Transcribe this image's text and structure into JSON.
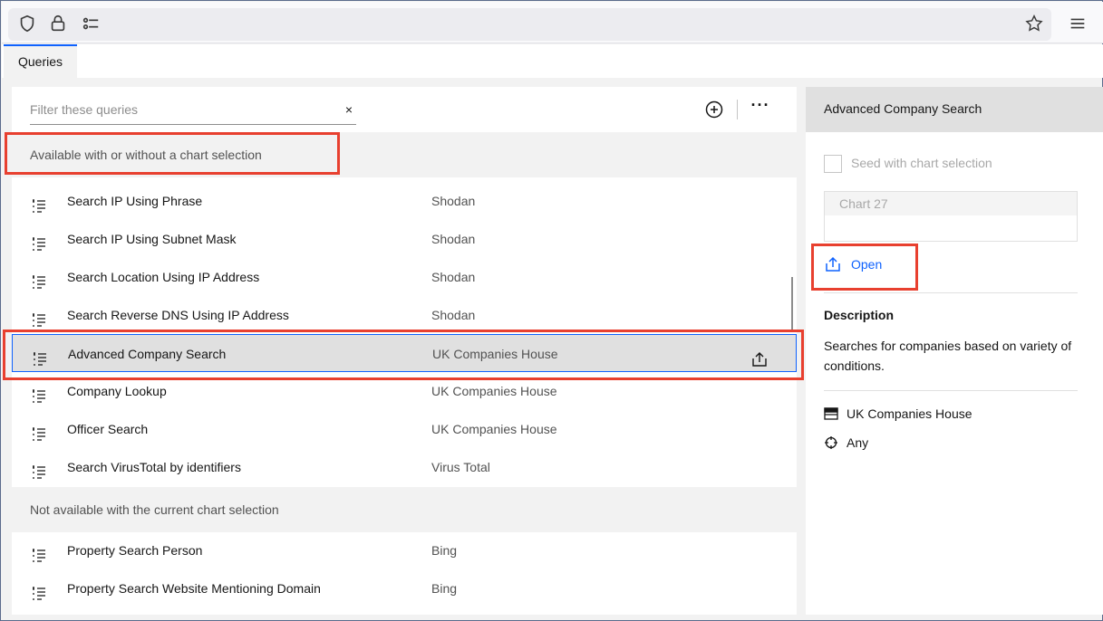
{
  "browser": {
    "icons": [
      "shield-icon",
      "lock-icon",
      "permissions-icon",
      "bookmark-star-icon",
      "hamburger-menu-icon"
    ]
  },
  "tabs": [
    {
      "label": "Queries"
    }
  ],
  "search": {
    "placeholder": "Filter these queries",
    "clear_label": "×"
  },
  "toolbar": {
    "more_label": "···"
  },
  "sections": {
    "available_label": "Available with or without a chart selection",
    "unavailable_label": "Not available with the current chart selection"
  },
  "available_queries": [
    {
      "name": "Search IP Using Phrase",
      "source": "Shodan"
    },
    {
      "name": "Search IP Using Subnet Mask",
      "source": "Shodan"
    },
    {
      "name": "Search Location Using IP Address",
      "source": "Shodan"
    },
    {
      "name": "Search Reverse DNS Using IP Address",
      "source": "Shodan"
    },
    {
      "name": "Advanced Company Search",
      "source": "UK Companies House"
    },
    {
      "name": "Company Lookup",
      "source": "UK Companies House"
    },
    {
      "name": "Officer Search",
      "source": "UK Companies House"
    },
    {
      "name": "Search VirusTotal by identifiers",
      "source": "Virus Total"
    }
  ],
  "unavailable_queries": [
    {
      "name": "Property Search Person",
      "source": "Bing"
    },
    {
      "name": "Property Search Website Mentioning Domain",
      "source": "Bing"
    }
  ],
  "details": {
    "title": "Advanced Company Search",
    "seed_label": "Seed with chart selection",
    "chart_label": "Chart 27",
    "open_label": "Open",
    "description_heading": "Description",
    "description": "Searches for companies based on variety of conditions.",
    "source": "UK Companies House",
    "target": "Any"
  },
  "colors": {
    "accent": "#0f62fe",
    "highlight": "#e8402f"
  }
}
